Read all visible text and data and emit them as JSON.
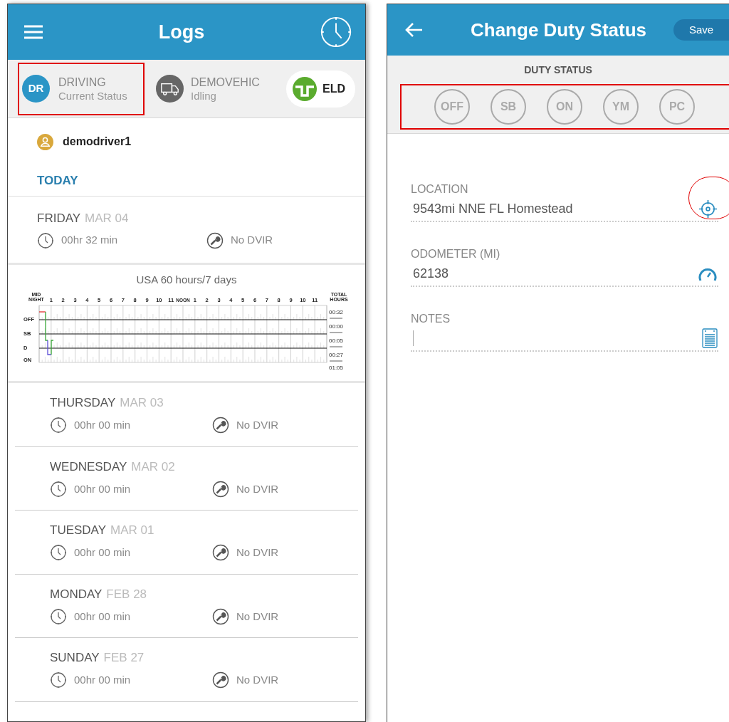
{
  "logs_screen": {
    "title": "Logs",
    "status_bar": {
      "driver_status": {
        "badge": "DR",
        "label": "DRIVING",
        "sublabel": "Current Status",
        "highlighted": true
      },
      "vehicle": {
        "name": "DEMOVEHIC",
        "state": "Idling"
      },
      "eld_button": "ELD"
    },
    "driver": "demodriver1",
    "section": "TODAY",
    "today": {
      "day": "FRIDAY",
      "date": "MAR 04",
      "duration": "00hr 32 min",
      "dvir": "No DVIR"
    },
    "graph": {
      "title": "USA 60 hours/7 days",
      "hour_labels": [
        "MID NIGHT",
        "1",
        "2",
        "3",
        "4",
        "5",
        "6",
        "7",
        "8",
        "9",
        "10",
        "11",
        "NOON",
        "1",
        "2",
        "3",
        "4",
        "5",
        "6",
        "7",
        "8",
        "9",
        "10",
        "11"
      ],
      "total_label": "TOTAL HOURS",
      "rows": [
        {
          "label": "OFF",
          "total": "00:32"
        },
        {
          "label": "SB",
          "total": "00:00"
        },
        {
          "label": "D",
          "total": "00:05"
        },
        {
          "label": "ON",
          "total": "00:27"
        }
      ],
      "grand_total": "01:05"
    },
    "days": [
      {
        "day": "THURSDAY",
        "date": "MAR 03",
        "duration": "00hr 00 min",
        "dvir": "No DVIR"
      },
      {
        "day": "WEDNESDAY",
        "date": "MAR 02",
        "duration": "00hr 00 min",
        "dvir": "No DVIR"
      },
      {
        "day": "TUESDAY",
        "date": "MAR 01",
        "duration": "00hr 00 min",
        "dvir": "No DVIR"
      },
      {
        "day": "MONDAY",
        "date": "FEB 28",
        "duration": "00hr 00 min",
        "dvir": "No DVIR"
      },
      {
        "day": "SUNDAY",
        "date": "FEB 27",
        "duration": "00hr 00 min",
        "dvir": "No DVIR"
      }
    ]
  },
  "duty_screen": {
    "title": "Change Duty Status",
    "save_button": "Save",
    "section": "DUTY STATUS",
    "statuses_highlighted": true,
    "statuses": [
      {
        "label": "OFF",
        "selected": false
      },
      {
        "label": "SB",
        "selected": false
      },
      {
        "label": "ON",
        "selected": false
      },
      {
        "label": "YM",
        "selected": false
      },
      {
        "label": "PC",
        "selected": false
      }
    ],
    "fields": [
      {
        "kind": "location",
        "label": "LOCATION",
        "value": "9543mi NNE FL Homestead",
        "highlighted": true
      },
      {
        "kind": "odometer",
        "label": "ODOMETER (MI)",
        "value": "62138",
        "highlighted": false
      },
      {
        "kind": "notes",
        "label": "NOTES",
        "highlighted": false
      }
    ]
  }
}
